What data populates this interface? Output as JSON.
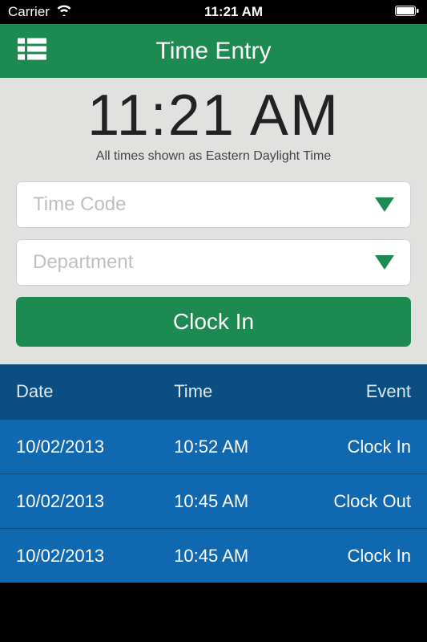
{
  "status": {
    "carrier": "Carrier",
    "time": "11:21 AM"
  },
  "header": {
    "title": "Time Entry"
  },
  "clock": {
    "time": "11:21 AM",
    "tz_note": "All times shown as Eastern Daylight Time"
  },
  "selects": {
    "time_code_label": "Time Code",
    "department_label": "Department"
  },
  "action": {
    "clock_in_label": "Clock In"
  },
  "table": {
    "headers": {
      "date": "Date",
      "time": "Time",
      "event": "Event"
    },
    "rows": [
      {
        "date": "10/02/2013",
        "time": "10:52 AM",
        "event": "Clock In"
      },
      {
        "date": "10/02/2013",
        "time": "10:45 AM",
        "event": "Clock Out"
      },
      {
        "date": "10/02/2013",
        "time": "10:45 AM",
        "event": "Clock In"
      }
    ]
  }
}
